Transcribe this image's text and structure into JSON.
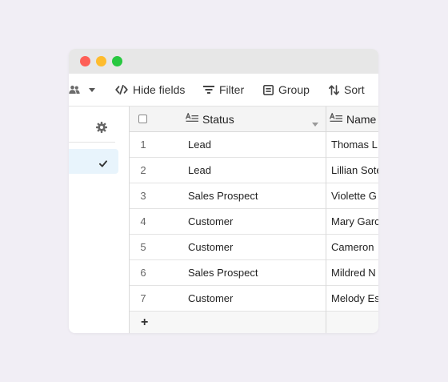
{
  "toolbar": {
    "hide_fields_label": "Hide fields",
    "filter_label": "Filter",
    "group_label": "Group",
    "sort_label": "Sort"
  },
  "table": {
    "columns": [
      "Status",
      "Name"
    ],
    "rows": [
      {
        "num": "1",
        "status": "Lead",
        "name": "Thomas L"
      },
      {
        "num": "2",
        "status": "Lead",
        "name": "Lillian Sote"
      },
      {
        "num": "3",
        "status": "Sales Prospect",
        "name": "Violette G"
      },
      {
        "num": "4",
        "status": "Customer",
        "name": "Mary Garc"
      },
      {
        "num": "5",
        "status": "Customer",
        "name": "Cameron"
      },
      {
        "num": "6",
        "status": "Sales Prospect",
        "name": "Mildred N"
      },
      {
        "num": "7",
        "status": "Customer",
        "name": "Melody Es"
      }
    ],
    "add_row_label": "+"
  },
  "colors": {
    "background": "#f1eef5",
    "titlebar": "#e7e7e7",
    "close": "#fe5f57",
    "minimize": "#febc2e",
    "maximize": "#28c840",
    "selected_item": "#e8f4fc"
  },
  "icons": [
    "people-icon",
    "chevron-down-icon",
    "hide-fields-icon",
    "filter-icon",
    "group-icon",
    "sort-icon",
    "gear-icon",
    "checkmark-icon",
    "text-field-icon",
    "sort-caret-icon"
  ]
}
